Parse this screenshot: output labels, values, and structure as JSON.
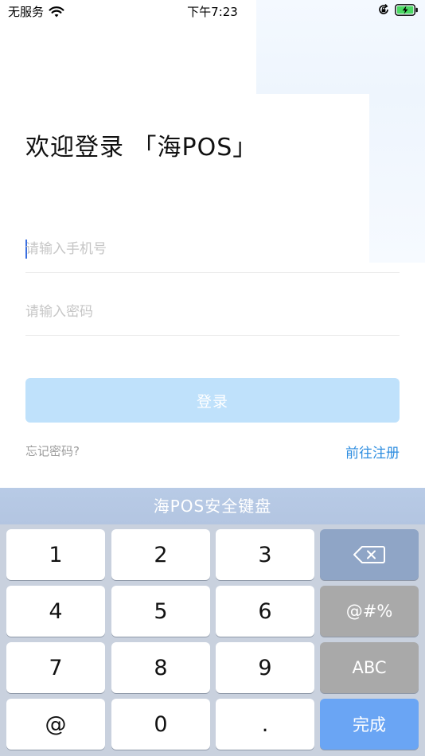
{
  "status_bar": {
    "carrier": "无服务",
    "time": "下午7:23"
  },
  "title": "欢迎登录 「海POS」",
  "form": {
    "phone_placeholder": "请输入手机号",
    "password_placeholder": "请输入密码",
    "login_label": "登录",
    "forgot_label": "忘记密码?",
    "register_label": "前往注册"
  },
  "keyboard": {
    "title": "海POS安全键盘",
    "keys": {
      "k1": "1",
      "k2": "2",
      "k3": "3",
      "k4": "4",
      "k5": "5",
      "k6": "6",
      "k7": "7",
      "k8": "8",
      "k9": "9",
      "at": "@",
      "k0": "0",
      "dot": ".",
      "symbol": "@#%",
      "abc": "ABC",
      "done": "完成"
    },
    "delete_icon": "backspace-icon"
  },
  "colors": {
    "accent": "#2f8ee0",
    "login_button_bg": "#bfe1fb",
    "keyboard_bg": "#c9d1de",
    "done_key": "#6aa5f4",
    "delete_key": "#8fa5c6",
    "function_key": "#a9a9a9"
  }
}
